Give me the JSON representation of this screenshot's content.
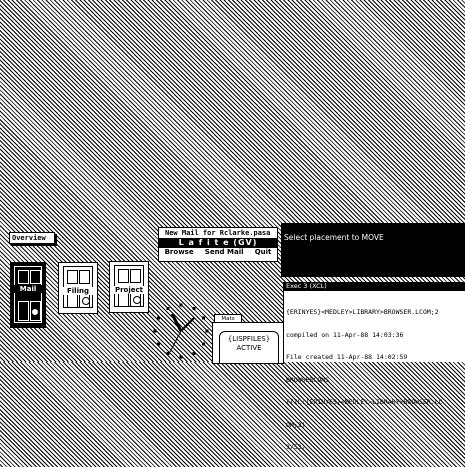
{
  "overview": {
    "label": "Overview"
  },
  "doors": [
    {
      "label": "Mail"
    },
    {
      "label": "Filing"
    },
    {
      "label": "Project"
    }
  ],
  "lafite": {
    "title": "New Mail for Rclarke.pasa",
    "banner": "L a f i t e   (GV)",
    "menu": [
      "Browse",
      "Send Mail",
      "Quit"
    ]
  },
  "prompt": {
    "text": "Select placement to MOVE"
  },
  "exec": {
    "title": "Exec 3 (XCL)",
    "lines": [
      "{ERINYES}<MEDLEY>LIBRARY>BROWSER.LCOM;2",
      "compiled on 11-Apr-88 14:03:36",
      "File created 11-Apr-88 14:02:59",
      "BROWSERCOMS",
      "({IL:{ERINYES}<MEDLEY>LIBRARY>BROWSER.LC",
      "OM;2)",
      "3/53)"
    ]
  },
  "folder": {
    "tab": "Mats",
    "line1": "{LISPFILES}",
    "line2": "ACTIVE"
  },
  "icons": {
    "clock": "analog-clock-icon",
    "door": "door-icon",
    "folder": "folder-icon"
  }
}
